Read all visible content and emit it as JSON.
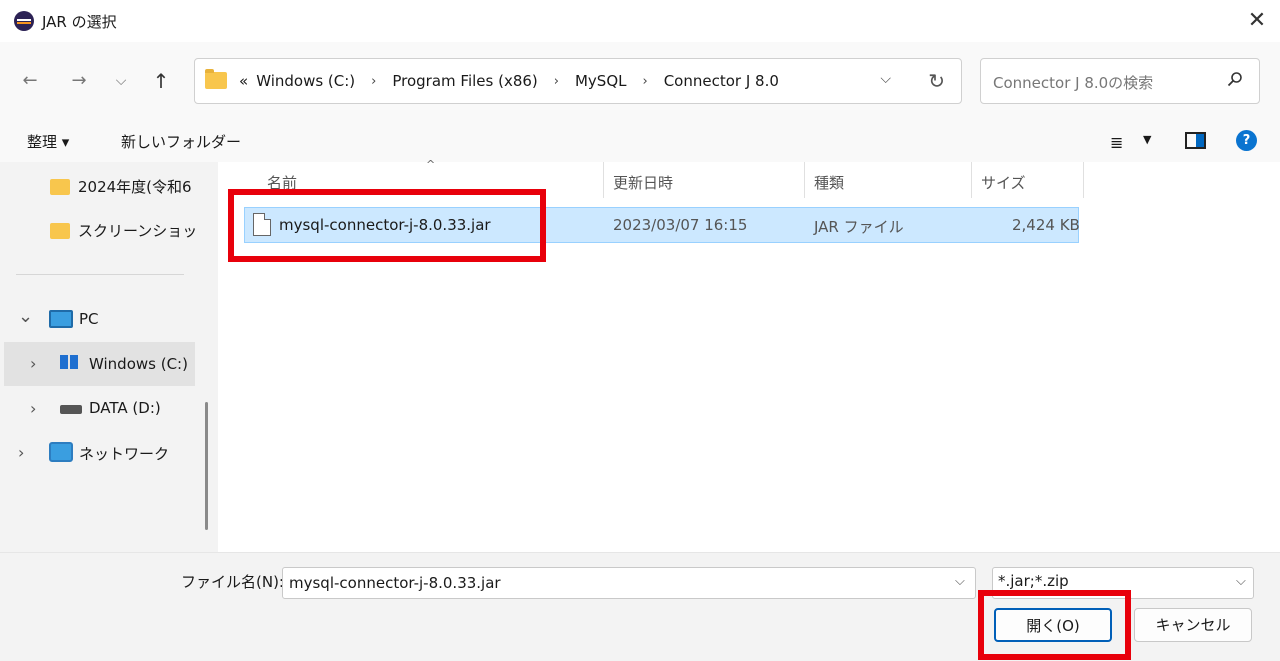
{
  "window": {
    "title": "JAR の選択",
    "close_glyph": "✕"
  },
  "nav": {
    "back_glyph": "←",
    "forward_glyph": "→",
    "recent_glyph": "⌵",
    "up_glyph": "↑"
  },
  "address": {
    "overflow": "«",
    "crumbs": [
      "Windows (C:)",
      "Program Files (x86)",
      "MySQL",
      "Connector J 8.0"
    ],
    "separator": "›",
    "dropdown_glyph": "⌵",
    "refresh_glyph": "↻"
  },
  "search": {
    "placeholder": "Connector J 8.0の検索"
  },
  "commands": {
    "organize": "整理 ▾",
    "new_folder": "新しいフォルダー",
    "view_glyph": "≣",
    "view_drop": "▼",
    "help": "?"
  },
  "sidebar": {
    "items": [
      {
        "label": "2024年度(令和6"
      },
      {
        "label": "スクリーンショット"
      },
      {
        "label": "PC",
        "chevron": "⌄"
      },
      {
        "label": "Windows (C:)",
        "chevron": "›"
      },
      {
        "label": "DATA (D:)",
        "chevron": "›"
      },
      {
        "label": "ネットワーク",
        "chevron": "›"
      }
    ]
  },
  "file_list": {
    "sort_glyph": "^",
    "columns": [
      "名前",
      "更新日時",
      "種類",
      "サイズ"
    ],
    "rows": [
      {
        "name": "mysql-connector-j-8.0.33.jar",
        "modified": "2023/03/07 16:15",
        "type": "JAR ファイル",
        "size": "2,424 KB"
      }
    ]
  },
  "footer": {
    "filename_label": "ファイル名(N):",
    "filename_value": "mysql-connector-j-8.0.33.jar",
    "filter_value": "*.jar;*.zip",
    "dropdown_glyph": "⌵",
    "open_label": "開く(O)",
    "cancel_label": "キャンセル"
  },
  "colors": {
    "accent": "#005fb8",
    "selection": "#cce8ff",
    "highlight": "#e8000b"
  }
}
